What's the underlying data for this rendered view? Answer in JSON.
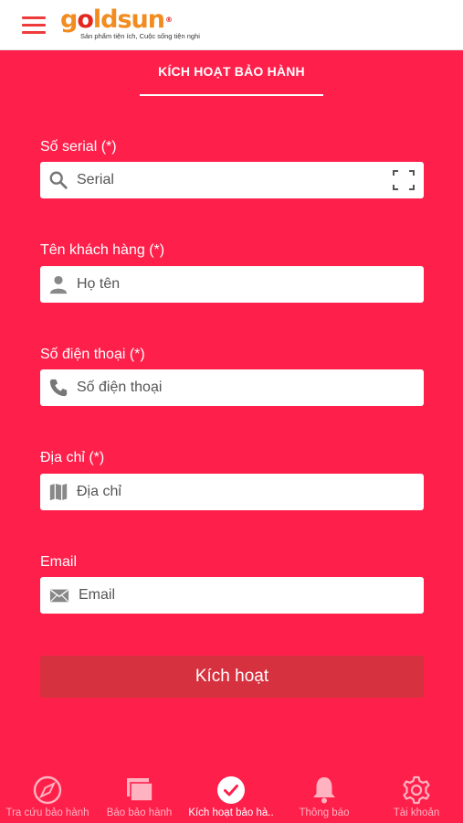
{
  "header": {
    "logo": {
      "prefix": "g",
      "highlight": "o",
      "rest": "ldsun",
      "reg": "®",
      "slogan": "Sản phẩm tiện ích, Cuộc sống tiện nghi"
    }
  },
  "page": {
    "title": "KÍCH HOẠT BẢO HÀNH"
  },
  "form": {
    "serial": {
      "label": "Số serial (*)",
      "placeholder": "Serial"
    },
    "name": {
      "label": "Tên khách hàng (*)",
      "placeholder": "Họ tên"
    },
    "phone": {
      "label": "Số điện thoại (*)",
      "placeholder": "Số điện thoại"
    },
    "address": {
      "label": "Địa chỉ (*)",
      "placeholder": "Địa chỉ"
    },
    "email": {
      "label": "Email",
      "placeholder": "Email"
    },
    "submit_label": "Kích hoạt"
  },
  "tabs": [
    {
      "label": "Tra cứu bảo hành",
      "icon": "compass-icon"
    },
    {
      "label": "Báo bảo hành",
      "icon": "cards-icon"
    },
    {
      "label": "Kích hoạt bảo hà..",
      "icon": "check-circle-icon",
      "active": true
    },
    {
      "label": "Thông báo",
      "icon": "bell-icon"
    },
    {
      "label": "Tài khoản",
      "icon": "gear-icon"
    }
  ],
  "colors": {
    "primary": "#ff1f4b",
    "button": "#d6313f",
    "logo_orange": "#f28c1f",
    "logo_red": "#e5261f"
  }
}
